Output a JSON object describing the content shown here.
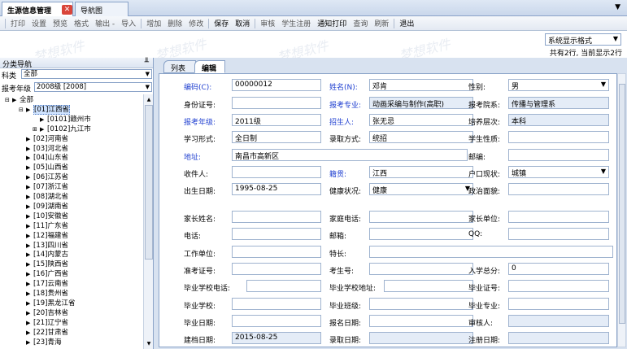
{
  "tabs": {
    "active": "生源信息管理",
    "other": "导航图",
    "close_glyph": "✕",
    "menu_glyph": "▼"
  },
  "toolbar": [
    {
      "label": "打印",
      "strong": false
    },
    {
      "label": "设置",
      "strong": false
    },
    {
      "label": "预览",
      "strong": false
    },
    {
      "label": "格式",
      "strong": false
    },
    {
      "label": "输出 -",
      "strong": false
    },
    {
      "label": "导入",
      "strong": false
    },
    {
      "sep": true
    },
    {
      "label": "增加",
      "strong": false
    },
    {
      "label": "删除",
      "strong": false
    },
    {
      "label": "修改",
      "strong": false
    },
    {
      "sep": true
    },
    {
      "label": "保存",
      "strong": true
    },
    {
      "label": "取消",
      "strong": true
    },
    {
      "sep": true
    },
    {
      "label": "审核",
      "strong": false
    },
    {
      "label": "学生注册",
      "strong": false
    },
    {
      "label": "通知打印",
      "strong": true
    },
    {
      "label": "查询",
      "strong": false
    },
    {
      "label": "刷新",
      "strong": false
    },
    {
      "sep": true
    },
    {
      "label": "退出",
      "strong": true
    }
  ],
  "watermark": "梦想软件",
  "display_format": "系统显示格式",
  "record_count": "共有2行, 当前显示2行",
  "left": {
    "title": "分类导航",
    "pin_glyph": "╨",
    "category_label": "科类",
    "category_value": "全部",
    "year_label": "报考年级",
    "year_value": "2008级 [2008]"
  },
  "tree": [
    {
      "text": "全部",
      "level": 0,
      "expander": "⊟",
      "node": "▶"
    },
    {
      "text": "[01]江西省",
      "level": 1,
      "expander": "⊟",
      "node": "▶",
      "selected": true
    },
    {
      "text": "[0101]赣州市",
      "level": 2,
      "expander": "",
      "node": "▶"
    },
    {
      "text": "[0102]九江市",
      "level": 2,
      "expander": "⊞",
      "node": "▶"
    },
    {
      "text": "[02]河南省",
      "level": 1,
      "expander": "",
      "node": "▶"
    },
    {
      "text": "[03]河北省",
      "level": 1,
      "expander": "",
      "node": "▶"
    },
    {
      "text": "[04]山东省",
      "level": 1,
      "expander": "",
      "node": "▶"
    },
    {
      "text": "[05]山西省",
      "level": 1,
      "expander": "",
      "node": "▶"
    },
    {
      "text": "[06]江苏省",
      "level": 1,
      "expander": "",
      "node": "▶"
    },
    {
      "text": "[07]浙江省",
      "level": 1,
      "expander": "",
      "node": "▶"
    },
    {
      "text": "[08]湖北省",
      "level": 1,
      "expander": "",
      "node": "▶"
    },
    {
      "text": "[09]湖南省",
      "level": 1,
      "expander": "",
      "node": "▶"
    },
    {
      "text": "[10]安徽省",
      "level": 1,
      "expander": "",
      "node": "▶"
    },
    {
      "text": "[11]广东省",
      "level": 1,
      "expander": "",
      "node": "▶"
    },
    {
      "text": "[12]福建省",
      "level": 1,
      "expander": "",
      "node": "▶"
    },
    {
      "text": "[13]四川省",
      "level": 1,
      "expander": "",
      "node": "▶"
    },
    {
      "text": "[14]内蒙古",
      "level": 1,
      "expander": "",
      "node": "▶"
    },
    {
      "text": "[15]陕西省",
      "level": 1,
      "expander": "",
      "node": "▶"
    },
    {
      "text": "[16]广西省",
      "level": 1,
      "expander": "",
      "node": "▶"
    },
    {
      "text": "[17]云南省",
      "level": 1,
      "expander": "",
      "node": "▶"
    },
    {
      "text": "[18]贵州省",
      "level": 1,
      "expander": "",
      "node": "▶"
    },
    {
      "text": "[19]黑龙江省",
      "level": 1,
      "expander": "",
      "node": "▶"
    },
    {
      "text": "[20]吉林省",
      "level": 1,
      "expander": "",
      "node": "▶"
    },
    {
      "text": "[21]辽宁省",
      "level": 1,
      "expander": "",
      "node": "▶"
    },
    {
      "text": "[22]甘肃省",
      "level": 1,
      "expander": "",
      "node": "▶"
    },
    {
      "text": "[23]青海",
      "level": 1,
      "expander": "",
      "node": "▶"
    }
  ],
  "right_tabs": {
    "list": "列表",
    "edit": "编辑"
  },
  "fields": {
    "code": {
      "label": "编码(C):",
      "value": ""
    },
    "name": {
      "label": "姓名(N):",
      "value": "邓肯"
    },
    "gender": {
      "label": "性别:",
      "value": "男"
    },
    "idcard": {
      "label": "身份证号:",
      "value": ""
    },
    "major": {
      "label": "报考专业:",
      "value": "动画采编与制作(高职)"
    },
    "dept": {
      "label": "报考院系:",
      "value": "传播与管理系"
    },
    "grade": {
      "label": "报考年级:",
      "value": "2011级"
    },
    "recruiter": {
      "label": "招生人:",
      "value": "张无忌"
    },
    "level": {
      "label": "培养层次:",
      "value": "本科"
    },
    "study": {
      "label": "学习形式:",
      "value": "全日制"
    },
    "admit_way": {
      "label": "录取方式:",
      "value": "统招"
    },
    "student_type": {
      "label": "学生性质:",
      "value": ""
    },
    "address": {
      "label": "地址:",
      "value": "南昌市高新区"
    },
    "postcode": {
      "label": "邮编:",
      "value": ""
    },
    "receiver": {
      "label": "收件人:",
      "value": ""
    },
    "native": {
      "label": "籍贯:",
      "value": "江西"
    },
    "hukou": {
      "label": "户口现状:",
      "value": "城镇"
    },
    "birthday": {
      "label": "出生日期:",
      "value": "1995-08-25"
    },
    "health": {
      "label": "健康状况:",
      "value": "健康"
    },
    "politics": {
      "label": "政治面貌:",
      "value": ""
    },
    "parent_name": {
      "label": "家长姓名:",
      "value": ""
    },
    "home_phone": {
      "label": "家庭电话:",
      "value": ""
    },
    "parent_unit": {
      "label": "家长单位:",
      "value": ""
    },
    "phone": {
      "label": "电话:",
      "value": ""
    },
    "email": {
      "label": "邮箱:",
      "value": ""
    },
    "qq": {
      "label": "QQ:",
      "value": ""
    },
    "work_unit": {
      "label": "工作单位:",
      "value": ""
    },
    "specialty": {
      "label": "特长:",
      "value": ""
    },
    "exam_no": {
      "label": "准考证号:",
      "value": ""
    },
    "exam_score": {
      "label": "考生号:",
      "value": ""
    },
    "total": {
      "label": "入学总分:",
      "value": "0"
    },
    "school_phone": {
      "label": "毕业学校电话:",
      "value": ""
    },
    "school_addr": {
      "label": "毕业学校地址:",
      "value": ""
    },
    "grad_no": {
      "label": "毕业证号:",
      "value": ""
    },
    "school": {
      "label": "毕业学校:",
      "value": ""
    },
    "grad_class": {
      "label": "毕业班级:",
      "value": ""
    },
    "grad_major": {
      "label": "毕业专业:",
      "value": ""
    },
    "grad_date": {
      "label": "毕业日期:",
      "value": ""
    },
    "apply_date": {
      "label": "报名日期:",
      "value": ""
    },
    "reviewer": {
      "label": "审核人:",
      "value": ""
    },
    "file_date": {
      "label": "建档日期:",
      "value": "2015-08-25"
    },
    "admit_date": {
      "label": "录取日期:",
      "value": ""
    },
    "reg_date": {
      "label": "注册日期:",
      "value": ""
    }
  },
  "code_value": "00000012"
}
